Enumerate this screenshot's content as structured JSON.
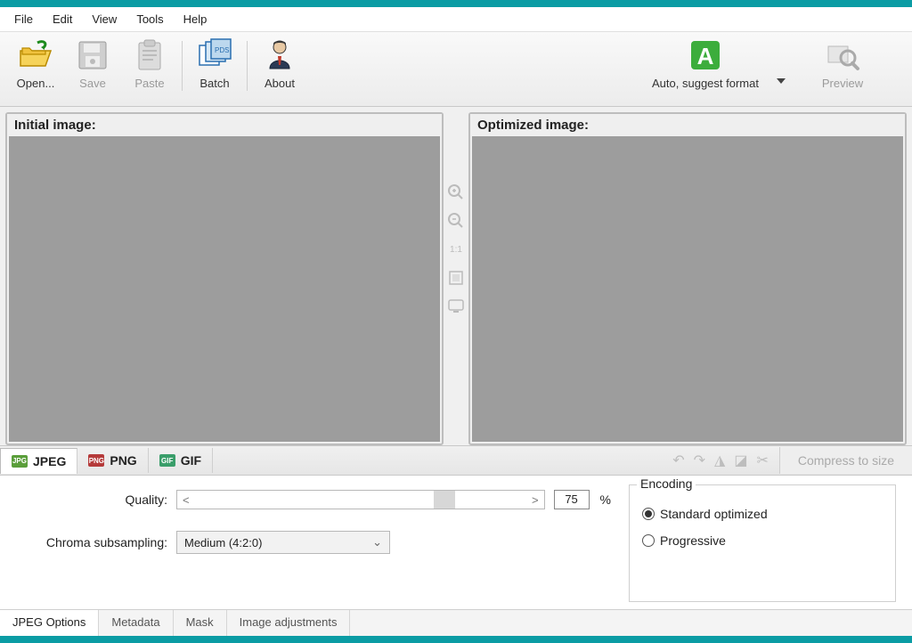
{
  "menubar": [
    "File",
    "Edit",
    "View",
    "Tools",
    "Help"
  ],
  "toolbar": {
    "open": "Open...",
    "save": "Save",
    "paste": "Paste",
    "batch": "Batch",
    "about": "About",
    "auto": "Auto, suggest format",
    "preview": "Preview"
  },
  "panels": {
    "left_title": "Initial image:",
    "right_title": "Optimized image:",
    "zoom_ratio": "1:1"
  },
  "format_tabs": {
    "jpeg": "JPEG",
    "png": "PNG",
    "gif": "GIF"
  },
  "compress_label": "Compress to size",
  "options": {
    "quality_label": "Quality:",
    "quality_value": "75",
    "quality_percent": "%",
    "slider_left": "<",
    "slider_right": ">",
    "chroma_label": "Chroma subsampling:",
    "chroma_value": "Medium (4:2:0)"
  },
  "encoding": {
    "legend": "Encoding",
    "standard": "Standard optimized",
    "progressive": "Progressive"
  },
  "bottom_tabs": [
    "JPEG Options",
    "Metadata",
    "Mask",
    "Image adjustments"
  ]
}
